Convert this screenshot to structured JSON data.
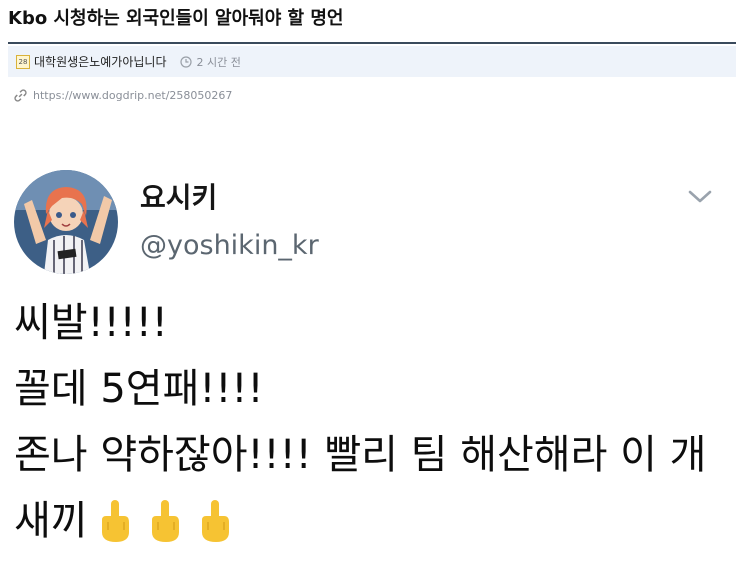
{
  "post": {
    "title": "Kbo 시청하는 외국인들이 알아둬야 할 명언",
    "author": "대학원생은노예가아닙니다",
    "author_badge": "28",
    "time_ago": "2 시간 전",
    "url": "https://www.dogdrip.net/258050267"
  },
  "tweet": {
    "display_name": "요시키",
    "handle": "@yoshikin_kr",
    "lines": [
      "씨발!!!!!",
      "꼴데 5연패!!!!",
      "존나 약하잖아!!!! 빨리 팀 해산해라 이 개",
      "새끼"
    ],
    "emoji_icons": [
      "middle-finger-icon",
      "middle-finger-icon",
      "middle-finger-icon"
    ]
  },
  "colors": {
    "title_rule": "#3a4a5c",
    "meta_bar_bg": "#eef3fa",
    "muted_text": "#8a8f98",
    "handle_text": "#5b6670",
    "emoji_yellow": "#f6c333"
  }
}
